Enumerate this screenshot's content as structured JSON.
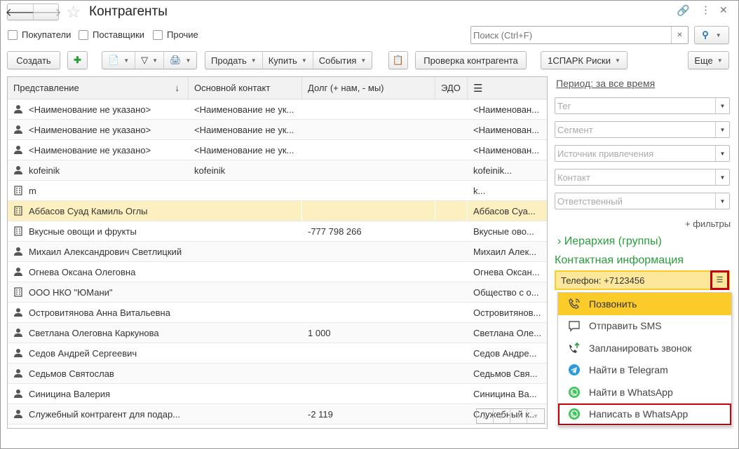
{
  "title": "Контрагенты",
  "filters": [
    "Покупатели",
    "Поставщики",
    "Прочие"
  ],
  "search": {
    "placeholder": "Поиск (Ctrl+F)"
  },
  "toolbar": {
    "create": "Создать",
    "sell": "Продать",
    "buy": "Купить",
    "events": "События",
    "check": "Проверка контрагента",
    "spark": "1СПАРК Риски",
    "more": "Еще"
  },
  "table": {
    "columns": [
      "Представление",
      "Основной контакт",
      "Долг (+ нам, - мы)",
      "ЭДО"
    ],
    "rows": [
      {
        "icon": "person",
        "name": "<Наименование не указано>",
        "contact": "<Наименование не ук...",
        "debt": "",
        "edo": "",
        "extra": "<Наименован..."
      },
      {
        "icon": "person",
        "name": "<Наименование не указано>",
        "contact": "<Наименование не ук...",
        "debt": "",
        "edo": "",
        "extra": "<Наименован..."
      },
      {
        "icon": "person",
        "name": "<Наименование не указано>",
        "contact": "<Наименование не ук...",
        "debt": "",
        "edo": "",
        "extra": "<Наименован..."
      },
      {
        "icon": "person",
        "name": "kofeinik",
        "contact": "kofeinik",
        "debt": "",
        "edo": "",
        "extra": "kofeinik..."
      },
      {
        "icon": "organization",
        "name": "m",
        "contact": "",
        "debt": "",
        "edo": "",
        "extra": "k..."
      },
      {
        "icon": "organization",
        "name": "Аббасов Суад Камиль Оглы",
        "contact": "",
        "debt": "",
        "edo": "",
        "extra": "Аббасов Суа...",
        "selected": true
      },
      {
        "icon": "organization",
        "name": "Вкусные овощи и фрукты",
        "contact": "",
        "debt": "-777 798 266",
        "edo": "",
        "extra": "Вкусные ово..."
      },
      {
        "icon": "person",
        "name": "Михаил Александрович Светлицкий",
        "contact": "",
        "debt": "",
        "edo": "",
        "extra": "Михаил Алек..."
      },
      {
        "icon": "person",
        "name": "Огнева Оксана Олеговна",
        "contact": "",
        "debt": "",
        "edo": "",
        "extra": "Огнева Оксан..."
      },
      {
        "icon": "organization",
        "name": "ООО НКО \"ЮМани\"",
        "contact": "",
        "debt": "",
        "edo": "",
        "extra": "Общество с о..."
      },
      {
        "icon": "person",
        "name": "Островитянова Анна Витальевна",
        "contact": "",
        "debt": "",
        "edo": "",
        "extra": "Островитянов..."
      },
      {
        "icon": "person",
        "name": "Светлана Олеговна Каркунова",
        "contact": "",
        "debt": "1 000",
        "edo": "",
        "extra": "Светлана Оле..."
      },
      {
        "icon": "person",
        "name": "Седов Андрей Сергеевич",
        "contact": "",
        "debt": "",
        "edo": "",
        "extra": "Седов Андре..."
      },
      {
        "icon": "person",
        "name": "Седьмов Святослав",
        "contact": "",
        "debt": "",
        "edo": "",
        "extra": "Седьмов Свя..."
      },
      {
        "icon": "person",
        "name": "Синицина Валерия",
        "contact": "",
        "debt": "",
        "edo": "",
        "extra": "Синицина Ва..."
      },
      {
        "icon": "person",
        "name": "Служебный контрагент для подар...",
        "contact": "",
        "debt": "-2 119",
        "edo": "",
        "extra": "Служебный к..."
      }
    ]
  },
  "side": {
    "period": "Период: за все время",
    "fields": [
      "Тег",
      "Сегмент",
      "Источник привлечения",
      "Контакт",
      "Ответственный"
    ],
    "more_filters": "+ фильтры",
    "hierarchy": "Иерархия (группы)",
    "contact_info": "Контактная информация",
    "phone": "Телефон: +7123456"
  },
  "menu": [
    {
      "label": "Позвонить",
      "icon": "phone-call"
    },
    {
      "label": "Отправить SMS",
      "icon": "sms"
    },
    {
      "label": "Запланировать звонок",
      "icon": "schedule-call"
    },
    {
      "label": "Найти в Telegram",
      "icon": "telegram"
    },
    {
      "label": "Найти в WhatsApp",
      "icon": "whatsapp"
    },
    {
      "label": "Написать в WhatsApp",
      "icon": "whatsapp"
    }
  ],
  "colors": {
    "accent": "#fbcb2a",
    "selection": "#fdf0c0",
    "highlight": "#c8000a",
    "green": "#2a9d3c"
  }
}
